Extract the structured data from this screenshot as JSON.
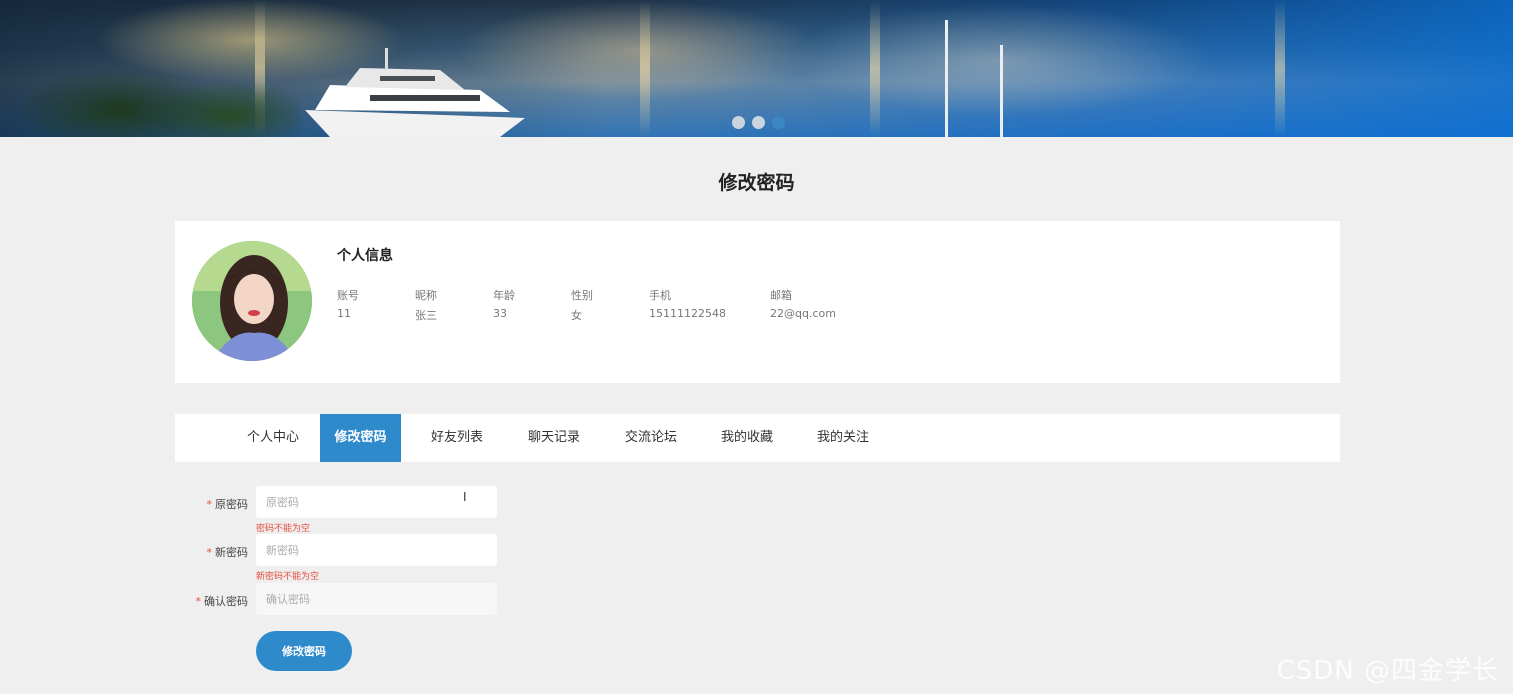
{
  "banner": {
    "slides": 3,
    "active_slide": 3
  },
  "page": {
    "title": "修改密码"
  },
  "profile": {
    "heading": "个人信息",
    "fields": [
      {
        "label": "账号",
        "value": "11"
      },
      {
        "label": "昵称",
        "value": "张三"
      },
      {
        "label": "年龄",
        "value": "33"
      },
      {
        "label": "性别",
        "value": "女"
      },
      {
        "label": "手机",
        "value": "15111122548"
      },
      {
        "label": "邮箱",
        "value": "22@qq.com"
      }
    ]
  },
  "tabs": [
    {
      "label": "个人中心",
      "active": false
    },
    {
      "label": "修改密码",
      "active": true
    },
    {
      "label": "好友列表",
      "active": false
    },
    {
      "label": "聊天记录",
      "active": false
    },
    {
      "label": "交流论坛",
      "active": false
    },
    {
      "label": "我的收藏",
      "active": false
    },
    {
      "label": "我的关注",
      "active": false
    }
  ],
  "form": {
    "old_password": {
      "label": "原密码",
      "placeholder": "原密码",
      "value": "",
      "error": "密码不能为空"
    },
    "new_password": {
      "label": "新密码",
      "placeholder": "新密码",
      "value": "",
      "error": "新密码不能为空"
    },
    "confirm_password": {
      "label": "确认密码",
      "placeholder": "确认密码",
      "value": ""
    },
    "required_mark": "*",
    "submit_label": "修改密码"
  },
  "cursor_glyph": "I",
  "watermark": "CSDN @四金学长",
  "colors": {
    "accent": "#2f8acb",
    "error": "#e74c3c",
    "page_bg": "#efefef"
  }
}
